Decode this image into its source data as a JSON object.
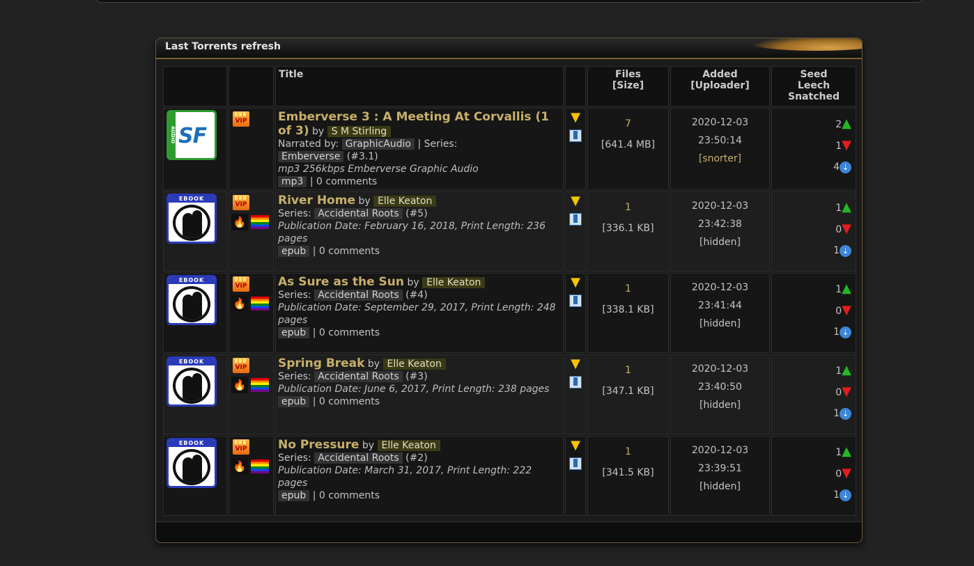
{
  "panel": {
    "title": "Last Torrents refresh"
  },
  "columns": {
    "title": "Title",
    "files": "Files",
    "size": "[Size]",
    "added": "Added",
    "uploader": "[Uploader]",
    "seed": "Seed",
    "leech": "Leech",
    "snatched": "Snatched"
  },
  "icons": {
    "category_audio_label": "AUDIO",
    "category_audio_logo": "SF",
    "category_ebook_label": "EBOOK",
    "vip_label": "VIP",
    "up_arrow": "▲",
    "down_arrow": "▼",
    "snatch_glyph": "⇣",
    "download_glyph": "▼",
    "fire_glyph": "🔥"
  },
  "torrents": [
    {
      "title": "Emberverse 3 : A Meeting At Corvallis (1 of 3)",
      "by": "by",
      "author": "S M Stirling",
      "narrated_label": "Narrated by:",
      "narrator": "GraphicAudio",
      "series_sep": "| Series:",
      "series": "Emberverse",
      "series_num": "(#3.1)",
      "description": "mp3 256kbps Emberverse Graphic Audio",
      "format": "mp3",
      "comments": "| 0 comments",
      "files": "7",
      "size": "[641.4 MB]",
      "date": "2020-12-03",
      "time": "23:50:14",
      "uploader": "[snorter]",
      "seeders": "2",
      "leechers": "1",
      "snatched": "4"
    },
    {
      "title": "River Home",
      "by": "by",
      "author": "Elle Keaton",
      "series_label": "Series:",
      "series": "Accidental Roots",
      "series_num": "(#5)",
      "description": "Publication Date: February 16, 2018, Print Length: 236 pages",
      "format": "epub",
      "comments": "| 0 comments",
      "files": "1",
      "size": "[336.1 KB]",
      "date": "2020-12-03",
      "time": "23:42:38",
      "uploader": "[hidden]",
      "seeders": "1",
      "leechers": "0",
      "snatched": "1"
    },
    {
      "title": "As Sure as the Sun",
      "by": "by",
      "author": "Elle Keaton",
      "series_label": "Series:",
      "series": "Accidental Roots",
      "series_num": "(#4)",
      "description": "Publication Date: September 29, 2017, Print Length: 248 pages",
      "format": "epub",
      "comments": "| 0 comments",
      "files": "1",
      "size": "[338.1 KB]",
      "date": "2020-12-03",
      "time": "23:41:44",
      "uploader": "[hidden]",
      "seeders": "1",
      "leechers": "0",
      "snatched": "1"
    },
    {
      "title": "Spring Break",
      "by": "by",
      "author": "Elle Keaton",
      "series_label": "Series:",
      "series": "Accidental Roots",
      "series_num": "(#3)",
      "description": "Publication Date: June 6, 2017, Print Length: 238 pages",
      "format": "epub",
      "comments": "| 0 comments",
      "files": "1",
      "size": "[347.1 KB]",
      "date": "2020-12-03",
      "time": "23:40:50",
      "uploader": "[hidden]",
      "seeders": "1",
      "leechers": "0",
      "snatched": "1"
    },
    {
      "title": "No Pressure",
      "by": "by",
      "author": "Elle Keaton",
      "series_label": "Series:",
      "series": "Accidental Roots",
      "series_num": "(#2)",
      "description": "Publication Date: March 31, 2017, Print Length: 222 pages",
      "format": "epub",
      "comments": "| 0 comments",
      "files": "1",
      "size": "[341.5 KB]",
      "date": "2020-12-03",
      "time": "23:39:51",
      "uploader": "[hidden]",
      "seeders": "1",
      "leechers": "0",
      "snatched": "1"
    }
  ]
}
